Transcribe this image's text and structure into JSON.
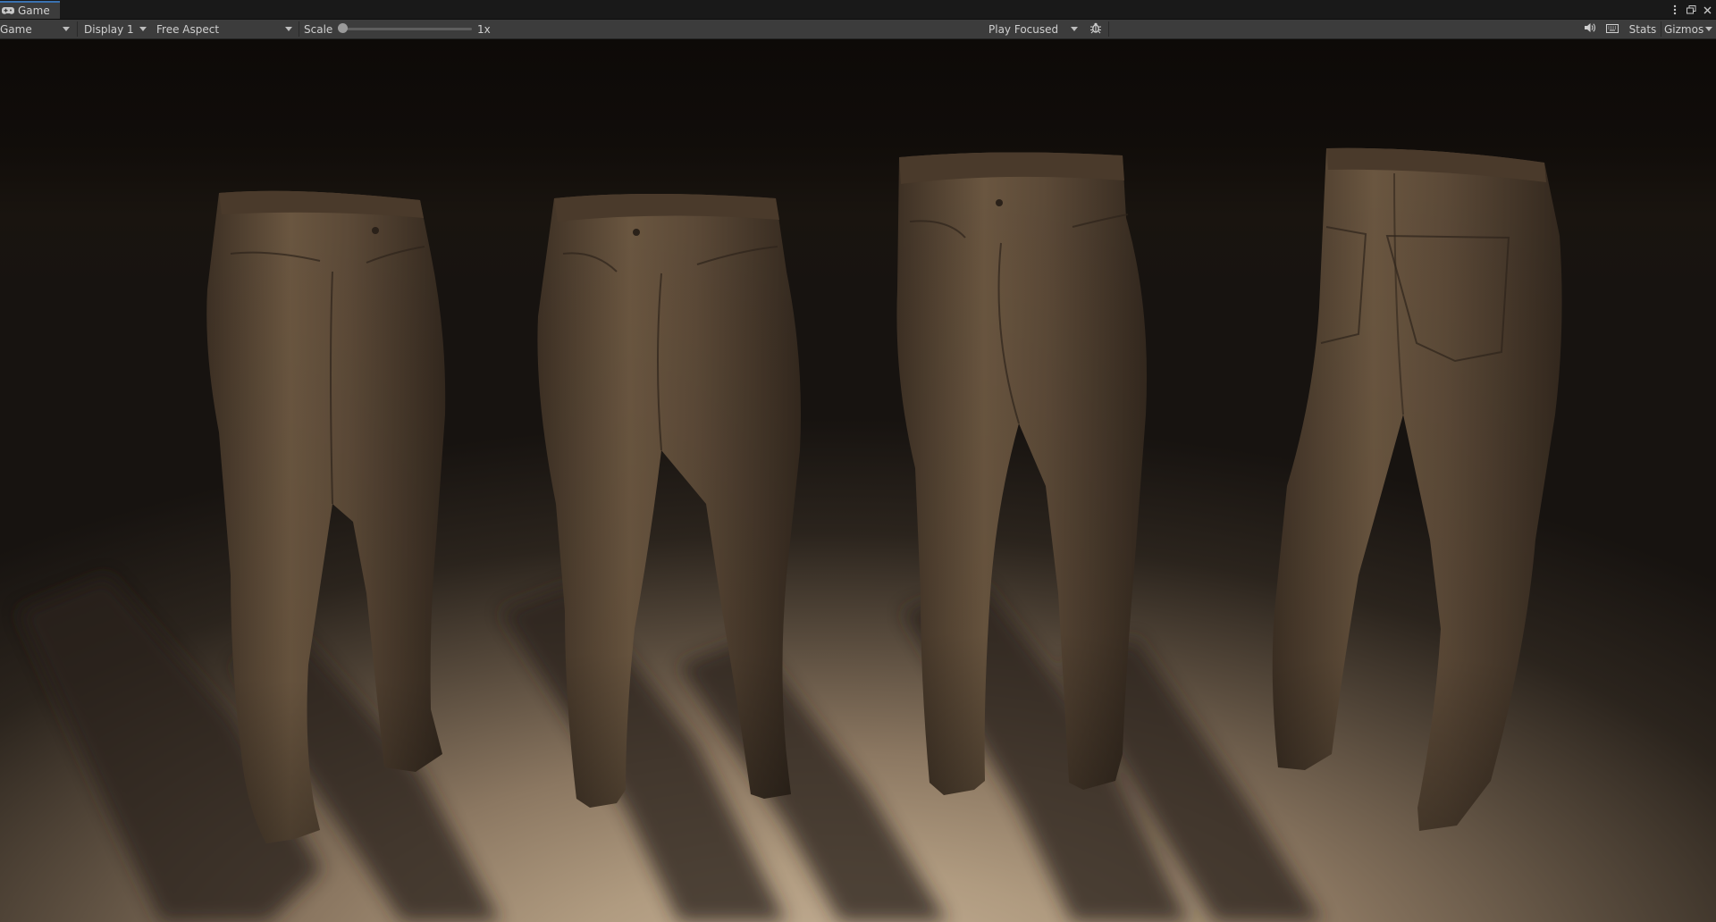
{
  "tab": {
    "title": "Game",
    "icon": "gamepad-icon"
  },
  "toolbar": {
    "view_mode": "Game",
    "display": "Display 1",
    "aspect": "Free Aspect",
    "scale_label": "Scale",
    "scale_value": "1x",
    "scale_fraction": 0.0,
    "play_mode": "Play Focused",
    "stats_label": "Stats",
    "gizmos_label": "Gizmos"
  },
  "scene": {
    "objects": [
      "pants-front-three-quarter",
      "pants-front",
      "pants-front-straight",
      "pants-back"
    ],
    "cloth_color": "#5a4835",
    "floor_color": "#c4ae93",
    "background_color": "#100c09"
  },
  "colors": {
    "panel": "#3c3c3c",
    "tab_accent": "#3a72b0",
    "window": "#191919"
  }
}
